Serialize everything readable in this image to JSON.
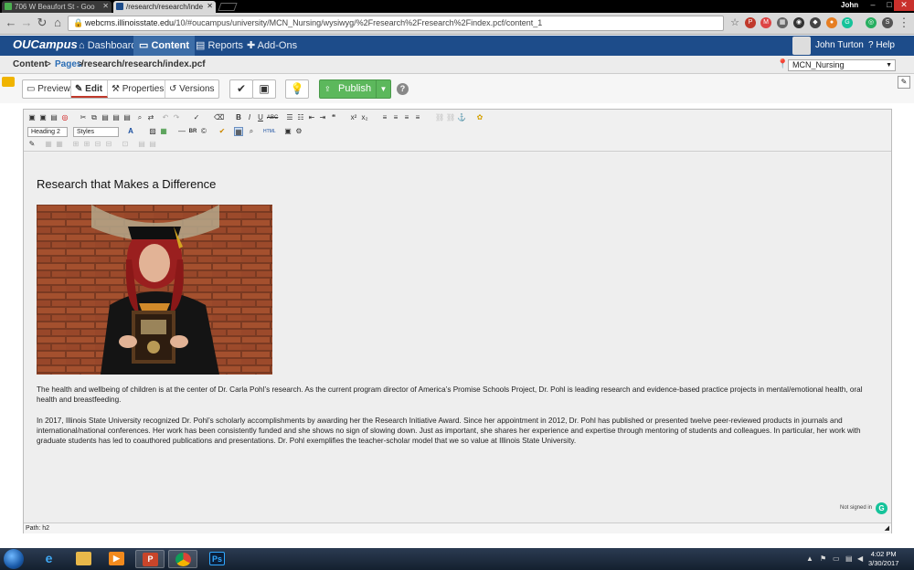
{
  "browser": {
    "tabs": [
      {
        "label": "706 W Beaufort St - Goo",
        "active": false
      },
      {
        "label": "/research/research/inde",
        "active": true
      }
    ],
    "os_user": "John",
    "address": {
      "host": "webcms.illinoisstate.edu",
      "path": "/10/#oucampus/university/MCN_Nursing/wysiwyg/%2Fresearch%2Fresearch%2Findex.pcf/content_1"
    }
  },
  "ou": {
    "logo": "OUCampus",
    "nav": [
      {
        "label": "Dashboard",
        "active": false
      },
      {
        "label": "Content",
        "active": true
      },
      {
        "label": "Reports",
        "active": false
      },
      {
        "label": "Add-Ons",
        "active": false
      }
    ],
    "user_name": "John Turton",
    "help_label": "Help"
  },
  "breadcrumb": {
    "content": "Content",
    "pages": "Pages",
    "path": "/research/research/index.pcf",
    "site": "MCN_Nursing"
  },
  "actions": {
    "preview": "Preview",
    "edit": "Edit",
    "properties": "Properties",
    "versions": "Versions",
    "publish": "Publish"
  },
  "editor": {
    "format_select": "Heading 2",
    "styles_select": "Styles",
    "heading": "Research that Makes a Difference",
    "paragraph1": "The health and wellbeing of children is at the center of Dr. Carla Pohl’s research. As the current program director of America’s Promise Schools Project, Dr. Pohl is leading research and evidence-based practice projects in mental/emotional health, oral health and breastfeeding.",
    "paragraph2": "In 2017, Illinois State University recognized Dr. Pohl’s scholarly accomplishments by awarding her the Research Initiative Award. Since her appointment in 2012, Dr. Pohl has published or presented twelve peer-reviewed products in journals and international/national conferences. Her work has been consistently funded and she shows no sign of slowing down. Just as important, she shares her experience and expertise through mentoring of students and colleagues. In particular, her work with graduate students has led to coauthored publications and presentations. Dr. Pohl exemplifies the teacher-scholar model that we so value at Illinois State University.",
    "grammarly": "Not signed in",
    "path": "Path: h2"
  },
  "taskbar": {
    "time": "4:02 PM",
    "date": "3/30/2017"
  },
  "colors": {
    "ou_nav": "#1d4c8a",
    "publish_green": "#5cb85c",
    "link_blue": "#2a6db5"
  }
}
